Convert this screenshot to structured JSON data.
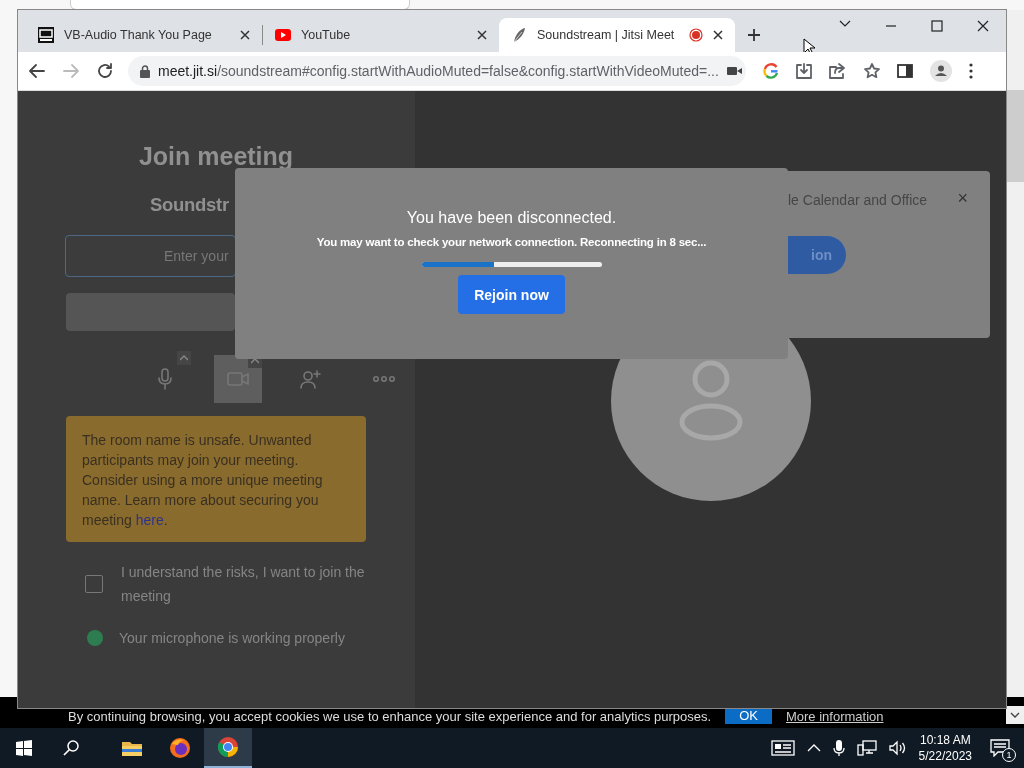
{
  "window": {
    "tabs": [
      {
        "kind": "vb",
        "title": "VB-Audio Thank You Page",
        "selected": false,
        "recording": false
      },
      {
        "kind": "youtube",
        "title": "YouTube",
        "selected": false,
        "recording": false
      },
      {
        "kind": "jitsi",
        "title": "Soundstream | Jitsi Meet",
        "selected": true,
        "recording": true
      }
    ],
    "nav": [
      {
        "kind": "back",
        "disabled": false
      },
      {
        "kind": "forward",
        "disabled": true
      },
      {
        "kind": "reload",
        "disabled": false
      }
    ],
    "url": {
      "host": "meet.jit.si",
      "rest": "/soundstream#config.startWithAudioMuted=false&config.startWithVideoMuted=..."
    }
  },
  "prejoin": {
    "title": "Join meeting",
    "room": "Soundstr",
    "name_field": {
      "placeholder": "Enter your"
    },
    "toolbar": [
      {
        "kind": "mic",
        "on": false
      },
      {
        "kind": "camera",
        "on": true
      },
      {
        "kind": "invite",
        "on": false
      },
      {
        "kind": "more",
        "on": false
      }
    ],
    "warning": "The room name is unsafe. Unwanted participants may join your meeting. Consider using a more unique meeting name. Learn more about securing you meeting ",
    "warning_link": "here",
    "warning_end": ".",
    "consent": {
      "label": "I understand the risks, I want to join the meeting",
      "checked": false
    },
    "mic_check": {
      "text": "Your microphone is working properly",
      "ok": true
    }
  },
  "notification": {
    "text": "le Calendar and Office",
    "close": "×",
    "button": "ion"
  },
  "dialog": {
    "title": "You have been disconnected.",
    "message": "You may want to check your network connection. Reconnecting in 8 sec...",
    "progress": {
      "level": 0.4
    },
    "button": "Rejoin now"
  },
  "cookie_bar": {
    "text": "By continuing browsing, you accept cookies we use to enhance your site experience and for analytics purposes.",
    "ok": "OK",
    "more": "More information"
  },
  "taskbar": {
    "apps": [
      {
        "kind": "explorer",
        "selected": false
      },
      {
        "kind": "firefox",
        "selected": false
      },
      {
        "kind": "chrome",
        "selected": true
      }
    ],
    "time": "10:18 AM",
    "date": "5/22/2023",
    "notifications": "1"
  }
}
